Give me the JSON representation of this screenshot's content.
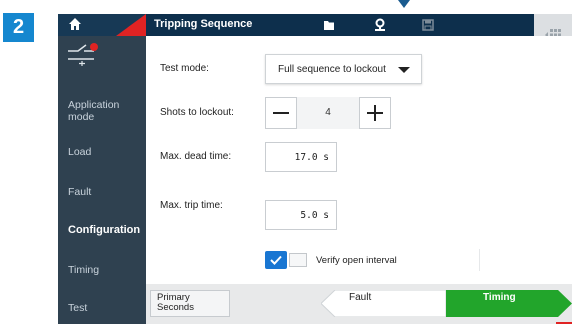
{
  "step_number": "2",
  "header": {
    "title": "Tripping Sequence",
    "icons": [
      "home-icon",
      "folder-icon",
      "pin-icon",
      "save-icon",
      "grid-icon"
    ]
  },
  "sidebar": {
    "items": [
      {
        "label": "Application mode",
        "active": false
      },
      {
        "label": "Load",
        "active": false
      },
      {
        "label": "Fault",
        "active": false
      },
      {
        "label": "Configuration",
        "active": true
      },
      {
        "label": "Timing",
        "active": false
      },
      {
        "label": "Test",
        "active": false
      }
    ]
  },
  "form": {
    "test_mode": {
      "label": "Test mode:",
      "value": "Full sequence to lockout"
    },
    "shots": {
      "label": "Shots to lockout:",
      "value": "4"
    },
    "dead_time": {
      "label": "Max. dead time:",
      "value": "17.0 s"
    },
    "trip_time": {
      "label": "Max. trip time:",
      "value": "5.0 s"
    },
    "verify": {
      "label": "Verify open interval",
      "checked": true
    }
  },
  "footer": {
    "primary": "Primary Seconds",
    "prev": "Fault",
    "next": "Timing"
  },
  "colors": {
    "accent_blue": "#1587cf",
    "active_green": "#22a52b",
    "alert_red": "#e02323",
    "topbar": "#0d2f4c",
    "sidebar": "#2f4150"
  }
}
